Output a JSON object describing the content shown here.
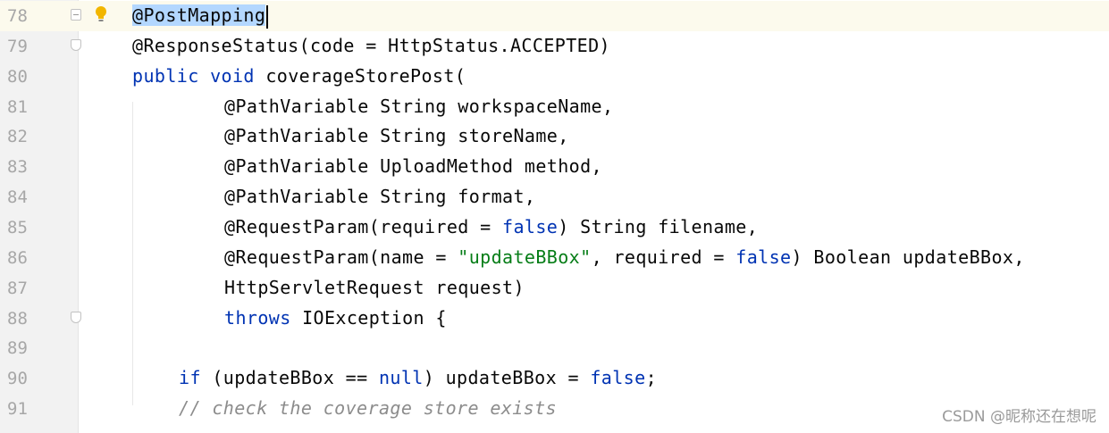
{
  "editor": {
    "lines": [
      {
        "num": "78",
        "segments": [
          {
            "t": "@PostMapping",
            "c": "sel"
          }
        ]
      },
      {
        "num": "79",
        "segments": [
          {
            "t": "@ResponseStatus(code = HttpStatus.ACCEPTED)",
            "c": ""
          }
        ]
      },
      {
        "num": "80",
        "segments": [
          {
            "t": "public",
            "c": "kw"
          },
          {
            "t": " ",
            "c": ""
          },
          {
            "t": "void",
            "c": "kw"
          },
          {
            "t": " coverageStorePost(",
            "c": ""
          }
        ]
      },
      {
        "num": "81",
        "segments": [
          {
            "t": "@PathVariable String workspaceName,",
            "c": ""
          }
        ]
      },
      {
        "num": "82",
        "segments": [
          {
            "t": "@PathVariable String storeName,",
            "c": ""
          }
        ]
      },
      {
        "num": "83",
        "segments": [
          {
            "t": "@PathVariable UploadMethod method,",
            "c": ""
          }
        ]
      },
      {
        "num": "84",
        "segments": [
          {
            "t": "@PathVariable String format,",
            "c": ""
          }
        ]
      },
      {
        "num": "85",
        "segments": [
          {
            "t": "@RequestParam(required = ",
            "c": ""
          },
          {
            "t": "false",
            "c": "kw"
          },
          {
            "t": ") String filename,",
            "c": ""
          }
        ]
      },
      {
        "num": "86",
        "segments": [
          {
            "t": "@RequestParam(name = ",
            "c": ""
          },
          {
            "t": "\"updateBBox\"",
            "c": "str"
          },
          {
            "t": ", required = ",
            "c": ""
          },
          {
            "t": "false",
            "c": "kw"
          },
          {
            "t": ") Boolean updateBBox,",
            "c": ""
          }
        ]
      },
      {
        "num": "87",
        "segments": [
          {
            "t": "HttpServletRequest request)",
            "c": ""
          }
        ]
      },
      {
        "num": "88",
        "segments": [
          {
            "t": "throws",
            "c": "kw"
          },
          {
            "t": " IOException {",
            "c": ""
          }
        ]
      },
      {
        "num": "89",
        "segments": []
      },
      {
        "num": "90",
        "segments": [
          {
            "t": "if",
            "c": "kw"
          },
          {
            "t": " (updateBBox == ",
            "c": ""
          },
          {
            "t": "null",
            "c": "kw"
          },
          {
            "t": ") updateBBox = ",
            "c": ""
          },
          {
            "t": "false",
            "c": "kw"
          },
          {
            "t": ";",
            "c": ""
          }
        ]
      },
      {
        "num": "91",
        "segments": [
          {
            "t": "// check the coverage store exists",
            "c": "cmt"
          }
        ]
      }
    ]
  },
  "watermark": "CSDN @昵称还在想呢",
  "icons": {
    "intention": "lightbulb-icon",
    "fold": "fold-marker-icon"
  },
  "colors": {
    "keyword": "#0033b3",
    "string": "#067d17",
    "comment": "#8c8c8c",
    "selection": "#b3d7ff"
  }
}
